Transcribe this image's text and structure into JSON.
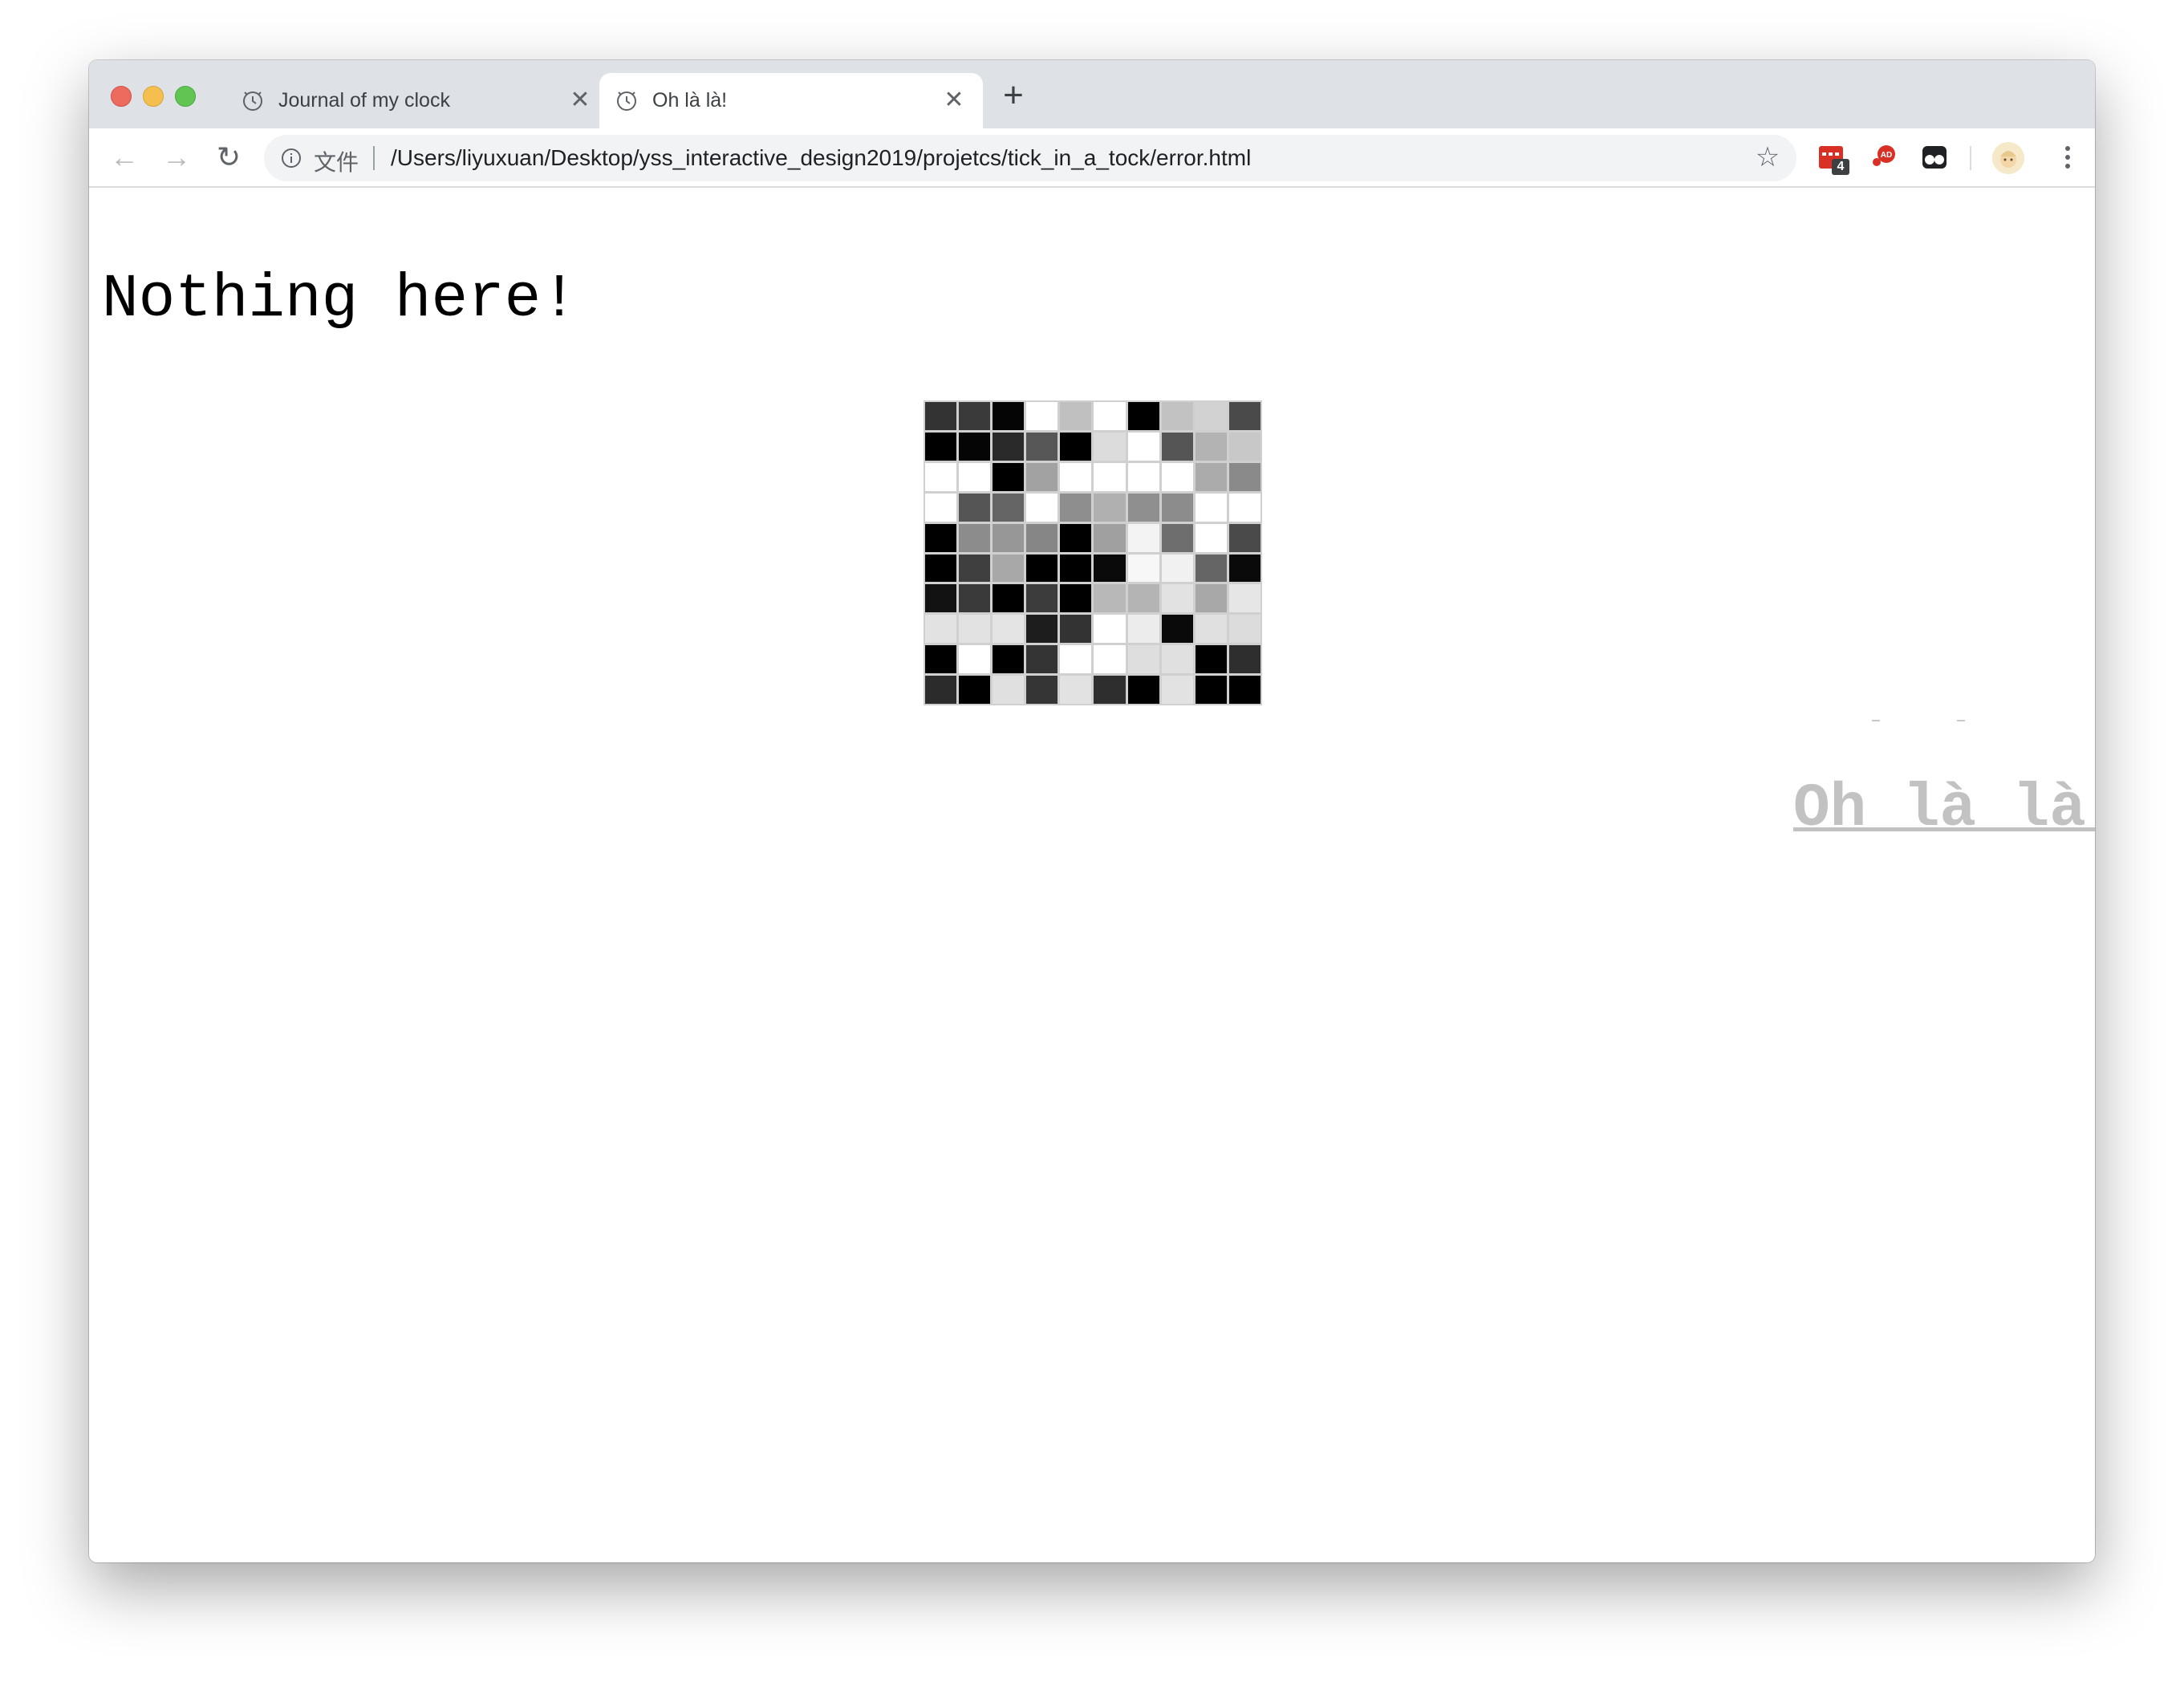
{
  "browser": {
    "tabs": [
      {
        "title": "Journal of my clock",
        "active": false,
        "favicon": "clock-icon"
      },
      {
        "title": "Oh là là!",
        "active": true,
        "favicon": "clock-icon"
      }
    ],
    "new_tab_symbol": "+",
    "address": {
      "scheme_label": "文件",
      "url": "/Users/liyuxuan/Desktop/yss_interactive_design2019/projetcs/tick_in_a_tock/error.html"
    },
    "extensions": [
      {
        "name": "calendar-extension-icon",
        "badge": "4",
        "color": "#d93025"
      },
      {
        "name": "adblock-extension-icon",
        "color": "#d93025"
      },
      {
        "name": "tampermonkey-extension-icon",
        "color": "#202124"
      }
    ]
  },
  "page": {
    "heading": "Nothing here!",
    "link": "Oh là là!",
    "pixel_grid": [
      [
        "#333333",
        "#3a3a3a",
        "#050505",
        "#ffffff",
        "#c0c0c0",
        "#ffffff",
        "#000000",
        "#c2c2c2",
        "#d2d2d2",
        "#4a4a4a"
      ],
      [
        "#000000",
        "#050505",
        "#2a2a2a",
        "#575757",
        "#000000",
        "#dcdcdc",
        "#ffffff",
        "#555555",
        "#b3b3b3",
        "#c8c8c8"
      ],
      [
        "#ffffff",
        "#ffffff",
        "#000000",
        "#a2a2a2",
        "#ffffff",
        "#ffffff",
        "#ffffff",
        "#ffffff",
        "#ababab",
        "#8a8a8a"
      ],
      [
        "#ffffff",
        "#555555",
        "#656565",
        "#ffffff",
        "#8e8e8e",
        "#b0b0b0",
        "#8f8f8f",
        "#8c8c8c",
        "#ffffff",
        "#ffffff"
      ],
      [
        "#000000",
        "#8c8c8c",
        "#979797",
        "#868686",
        "#000000",
        "#a0a0a0",
        "#f3f3f3",
        "#6e6e6e",
        "#ffffff",
        "#4a4a4a"
      ],
      [
        "#000000",
        "#3f3f3f",
        "#a8a8a8",
        "#000000",
        "#000000",
        "#0a0a0a",
        "#f7f7f7",
        "#f1f1f1",
        "#656565",
        "#0a0a0a"
      ],
      [
        "#121212",
        "#3a3a3a",
        "#000000",
        "#3c3c3c",
        "#000000",
        "#b8b8b8",
        "#b4b4b4",
        "#e2e2e2",
        "#a8a8a8",
        "#e6e6e6"
      ],
      [
        "#e2e2e2",
        "#e2e2e2",
        "#e4e4e4",
        "#1d1d1d",
        "#333333",
        "#ffffff",
        "#ececec",
        "#0a0a0a",
        "#e0e0e0",
        "#dcdcdc"
      ],
      [
        "#000000",
        "#ffffff",
        "#000000",
        "#343434",
        "#ffffff",
        "#ffffff",
        "#dedede",
        "#e0e0e0",
        "#000000",
        "#2e2e2e"
      ],
      [
        "#2b2b2b",
        "#000000",
        "#e0e0e0",
        "#353535",
        "#e2e2e2",
        "#2e2e2e",
        "#000000",
        "#e2e2e2",
        "#000000",
        "#000000"
      ]
    ]
  }
}
